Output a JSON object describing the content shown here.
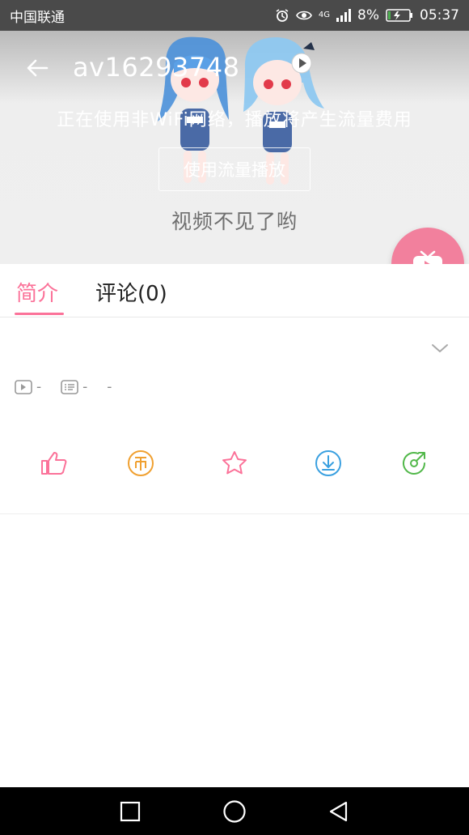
{
  "status_bar": {
    "carrier": "中国联通",
    "network": "4G",
    "battery": "8%",
    "time": "05:37",
    "icons": [
      "alarm-icon",
      "eye-icon",
      "signal-icon",
      "battery-charging-icon"
    ]
  },
  "player": {
    "title": "av16293748",
    "notice": "正在使用非WiFi网络，播放将产生流量费用",
    "data_play_label": "使用流量播放",
    "error": "视频不见了哟"
  },
  "tabs": [
    {
      "label": "简介",
      "active": true
    },
    {
      "label": "评论(0)",
      "active": false
    }
  ],
  "stats": {
    "plays": "-",
    "danmaku": "-",
    "date": "-"
  },
  "actions": [
    "like-icon",
    "coin-icon",
    "favorite-icon",
    "download-icon",
    "share-icon"
  ],
  "colors": {
    "accent": "#fb7299",
    "fab": "#f2809d",
    "coin": "#f0a030",
    "star": "#fb7299",
    "download": "#3aa0e0",
    "share": "#52b84a"
  }
}
